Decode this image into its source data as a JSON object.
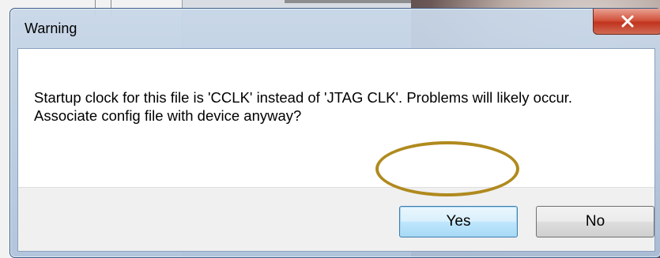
{
  "dialog": {
    "title": "Warning",
    "close_icon": "close-icon",
    "message_lines": [
      "Startup clock for this file is 'CCLK' instead of 'JTAG CLK'.  Problems will likely occur.",
      "Associate config file with device anyway?"
    ],
    "buttons": {
      "yes": "Yes",
      "no": "No"
    }
  },
  "colors": {
    "close_button": "#c1341e",
    "default_button_border": "#3c7fb1",
    "highlight_ring": "#b08a1e"
  }
}
